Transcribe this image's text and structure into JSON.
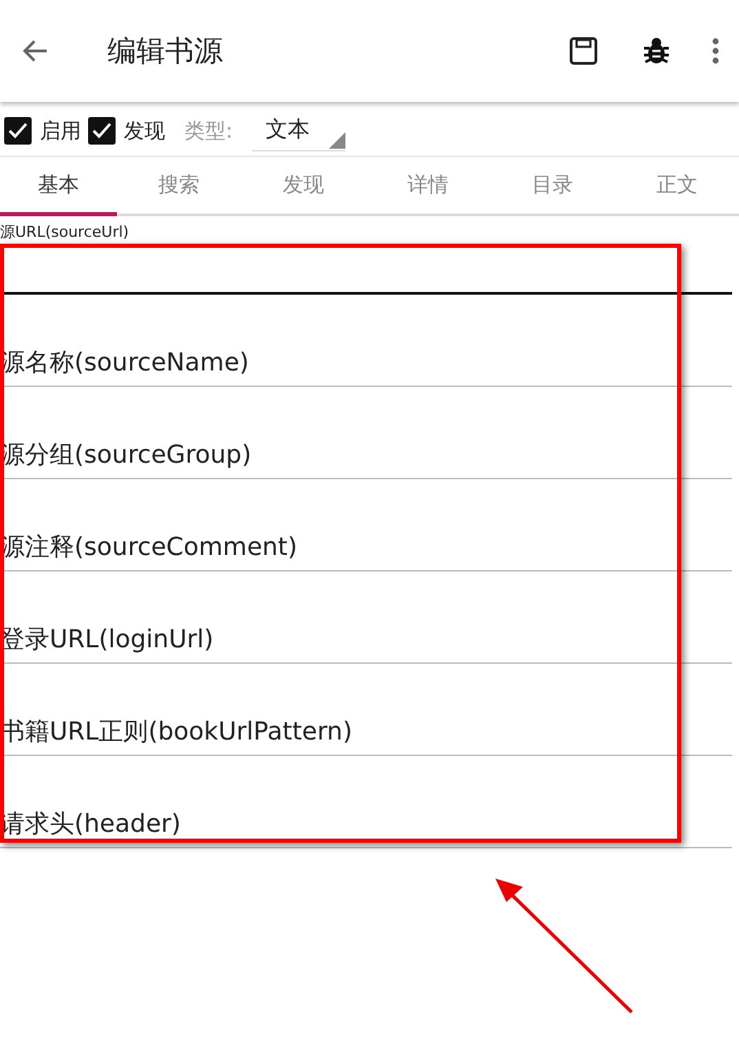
{
  "toolbar": {
    "title": "编辑书源"
  },
  "options": {
    "checkboxes": [
      {
        "label": "启用",
        "checked": true
      },
      {
        "label": "发现",
        "checked": true
      }
    ],
    "type_label": "类型:",
    "type_value": "文本"
  },
  "tabs": [
    {
      "label": "基本",
      "selected": true
    },
    {
      "label": "搜索",
      "selected": false
    },
    {
      "label": "发现",
      "selected": false
    },
    {
      "label": "详情",
      "selected": false
    },
    {
      "label": "目录",
      "selected": false
    },
    {
      "label": "正文",
      "selected": false
    }
  ],
  "fields": [
    {
      "label": "源URL(sourceUrl)",
      "focused": true
    },
    {
      "placeholder": "源名称(sourceName)",
      "focused": false
    },
    {
      "placeholder": "源分组(sourceGroup)",
      "focused": false
    },
    {
      "placeholder": "源注释(sourceComment)",
      "focused": false
    },
    {
      "placeholder": "登录URL(loginUrl)",
      "focused": false
    },
    {
      "placeholder": "书籍URL正则(bookUrlPattern)",
      "focused": false
    },
    {
      "placeholder": "请求头(header)",
      "focused": false
    }
  ]
}
